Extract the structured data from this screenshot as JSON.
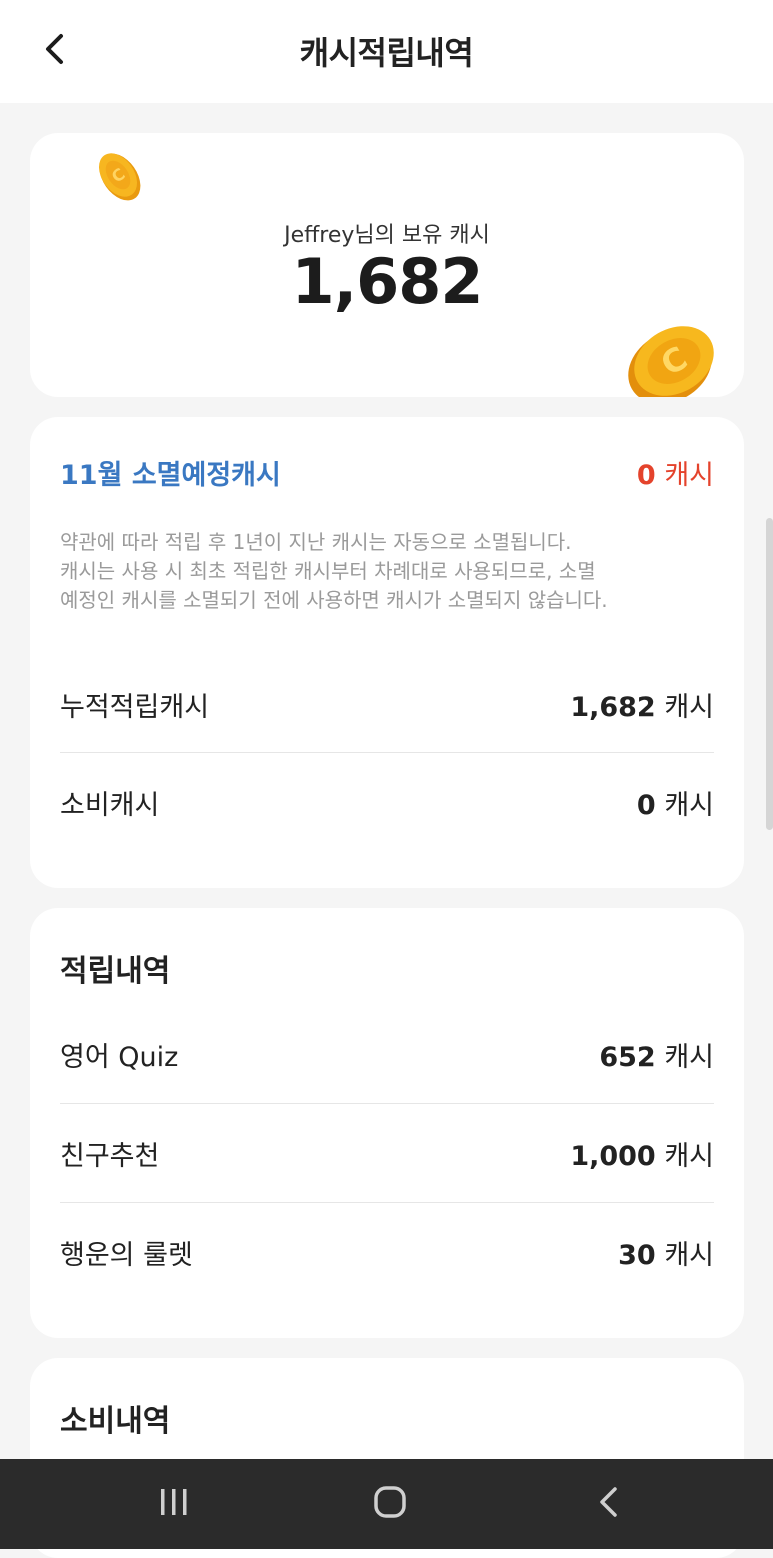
{
  "header": {
    "title": "캐시적립내역",
    "back_icon": "chevron-left-icon"
  },
  "balance": {
    "label": "Jeffrey님의 보유 캐시",
    "value": "1,682",
    "coin_icon": "coin-icon"
  },
  "summary": {
    "expire_label": "11월 소멸예정캐시",
    "expire_value": "0",
    "expire_unit": "캐시",
    "notice_lines": [
      "약관에 따라 적립 후 1년이 지난 캐시는 자동으로 소멸됩니다.",
      "캐시는 사용 시 최초 적립한 캐시부터 차례대로 사용되므로, 소멸",
      "예정인 캐시를 소멸되기 전에 사용하면 캐시가 소멸되지 않습니다."
    ],
    "rows": [
      {
        "label": "누적적립캐시",
        "value": "1,682",
        "unit": "캐시"
      },
      {
        "label": "소비캐시",
        "value": "0",
        "unit": "캐시"
      }
    ]
  },
  "earned": {
    "title": "적립내역",
    "rows": [
      {
        "label": "영어 Quiz",
        "value": "652",
        "unit": "캐시"
      },
      {
        "label": "친구추천",
        "value": "1,000",
        "unit": "캐시"
      },
      {
        "label": "행운의 룰렛",
        "value": "30",
        "unit": "캐시"
      }
    ]
  },
  "spent": {
    "title": "소비내역"
  },
  "navbar": {
    "recents_icon": "recents-icon",
    "home_icon": "home-icon",
    "back_icon": "nav-back-icon"
  },
  "colors": {
    "accent_blue": "#3a78c2",
    "alert_red": "#e4432c",
    "coin_gold": "#f5b21a"
  }
}
